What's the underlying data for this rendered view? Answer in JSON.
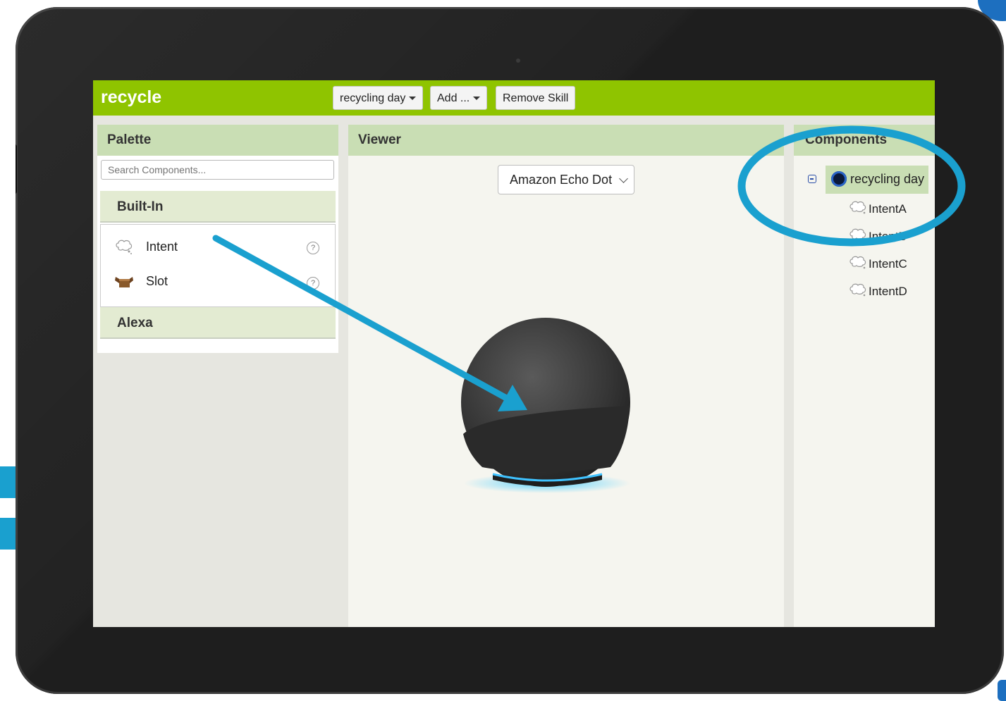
{
  "app": {
    "title": "recycle"
  },
  "toolbar": {
    "skill_dropdown": "recycling day",
    "add_dropdown": "Add ...",
    "remove_button": "Remove Skill"
  },
  "palette": {
    "header": "Palette",
    "search_placeholder": "Search Components...",
    "categories": [
      {
        "label": "Built-In",
        "items": [
          {
            "label": "Intent",
            "icon": "thought-bubble-icon"
          },
          {
            "label": "Slot",
            "icon": "box-icon"
          }
        ]
      },
      {
        "label": "Alexa"
      }
    ]
  },
  "viewer": {
    "header": "Viewer",
    "device": "Amazon Echo Dot"
  },
  "components": {
    "header": "Components",
    "root": "recycling day",
    "children": [
      "IntentA",
      "IntentB",
      "IntentC",
      "IntentD"
    ]
  },
  "colors": {
    "topbar": "#8fc400",
    "annotation": "#1aa0cf"
  }
}
